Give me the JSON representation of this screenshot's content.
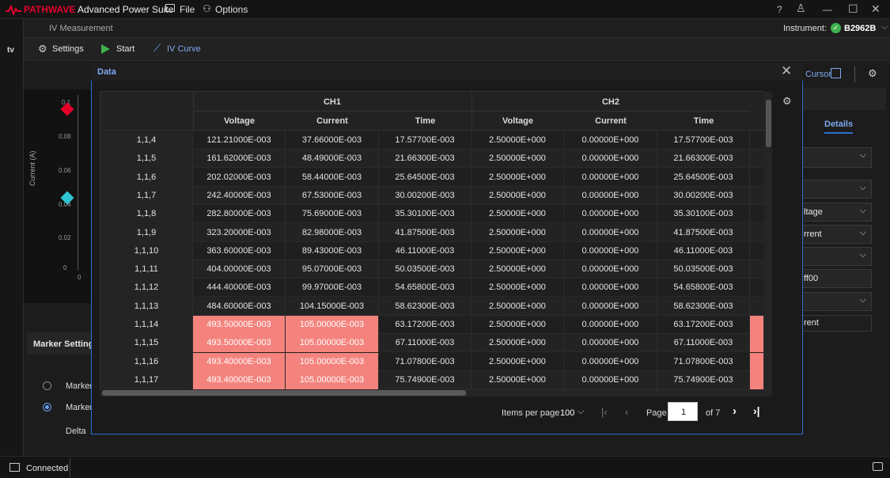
{
  "app": {
    "brand": "PATHWAVE",
    "title": "Advanced Power Suite",
    "menu_file": "File",
    "menu_options": "Options",
    "win_help": "?",
    "win_user": "♙",
    "win_min": "—",
    "win_max": "☐",
    "win_close": "✕"
  },
  "subheader": {
    "title": "IV Measurement",
    "instrument_label": "Instrument:",
    "instrument_name": "B2962B"
  },
  "toolbar": {
    "settings": "Settings",
    "start": "Start",
    "iv_curve": "IV Curve"
  },
  "left_strip": {
    "tv_label": "tv"
  },
  "chart_axis": {
    "ylabel": "Current (A)",
    "ticks": [
      "0.1",
      "0.08",
      "0.06",
      "0.04",
      "0.02",
      "0",
      "0"
    ]
  },
  "right_panel": {
    "cursor_label": "Cursor",
    "details_tab": "Details",
    "voltage_text": "ltage",
    "current_text": "rrent",
    "color_text": "ff00",
    "current_text2": "rent"
  },
  "marker": {
    "settings_label": "Marker Settings",
    "marker1": "Marker",
    "marker2": "Marker",
    "delta": "Delta"
  },
  "modal": {
    "title": "Data",
    "ch1": "CH1",
    "ch2": "CH2",
    "col_voltage": "Voltage",
    "col_current": "Current",
    "col_time": "Time",
    "rows": [
      {
        "id": "1,1,4",
        "v1": "121.21000E-003",
        "c1": "37.66000E-003",
        "t1": "17.57700E-003",
        "v2": "2.50000E+000",
        "c2": "0.00000E+000",
        "t2": "17.57700E-003",
        "hl": false
      },
      {
        "id": "1,1,5",
        "v1": "161.62000E-003",
        "c1": "48.49000E-003",
        "t1": "21.66300E-003",
        "v2": "2.50000E+000",
        "c2": "0.00000E+000",
        "t2": "21.66300E-003",
        "hl": false
      },
      {
        "id": "1,1,6",
        "v1": "202.02000E-003",
        "c1": "58.44000E-003",
        "t1": "25.64500E-003",
        "v2": "2.50000E+000",
        "c2": "0.00000E+000",
        "t2": "25.64500E-003",
        "hl": false
      },
      {
        "id": "1,1,7",
        "v1": "242.40000E-003",
        "c1": "67.53000E-003",
        "t1": "30.00200E-003",
        "v2": "2.50000E+000",
        "c2": "0.00000E+000",
        "t2": "30.00200E-003",
        "hl": false
      },
      {
        "id": "1,1,8",
        "v1": "282.80000E-003",
        "c1": "75.69000E-003",
        "t1": "35.30100E-003",
        "v2": "2.50000E+000",
        "c2": "0.00000E+000",
        "t2": "35.30100E-003",
        "hl": false
      },
      {
        "id": "1,1,9",
        "v1": "323.20000E-003",
        "c1": "82.98000E-003",
        "t1": "41.87500E-003",
        "v2": "2.50000E+000",
        "c2": "0.00000E+000",
        "t2": "41.87500E-003",
        "hl": false
      },
      {
        "id": "1,1,10",
        "v1": "363.60000E-003",
        "c1": "89.43000E-003",
        "t1": "46.11000E-003",
        "v2": "2.50000E+000",
        "c2": "0.00000E+000",
        "t2": "46.11000E-003",
        "hl": false
      },
      {
        "id": "1,1,11",
        "v1": "404.00000E-003",
        "c1": "95.07000E-003",
        "t1": "50.03500E-003",
        "v2": "2.50000E+000",
        "c2": "0.00000E+000",
        "t2": "50.03500E-003",
        "hl": false
      },
      {
        "id": "1,1,12",
        "v1": "444.40000E-003",
        "c1": "99.97000E-003",
        "t1": "54.65800E-003",
        "v2": "2.50000E+000",
        "c2": "0.00000E+000",
        "t2": "54.65800E-003",
        "hl": false
      },
      {
        "id": "1,1,13",
        "v1": "484.60000E-003",
        "c1": "104.15000E-003",
        "t1": "58.62300E-003",
        "v2": "2.50000E+000",
        "c2": "0.00000E+000",
        "t2": "58.62300E-003",
        "hl": false
      },
      {
        "id": "1,1,14",
        "v1": "493.50000E-003",
        "c1": "105.00000E-003",
        "t1": "63.17200E-003",
        "v2": "2.50000E+000",
        "c2": "0.00000E+000",
        "t2": "63.17200E-003",
        "hl": true
      },
      {
        "id": "1,1,15",
        "v1": "493.50000E-003",
        "c1": "105.00000E-003",
        "t1": "67.11000E-003",
        "v2": "2.50000E+000",
        "c2": "0.00000E+000",
        "t2": "67.11000E-003",
        "hl": true
      },
      {
        "id": "1,1,16",
        "v1": "493.40000E-003",
        "c1": "105.00000E-003",
        "t1": "71.07800E-003",
        "v2": "2.50000E+000",
        "c2": "0.00000E+000",
        "t2": "71.07800E-003",
        "hl": true
      },
      {
        "id": "1,1,17",
        "v1": "493.40000E-003",
        "c1": "105.00000E-003",
        "t1": "75.74900E-003",
        "v2": "2.50000E+000",
        "c2": "0.00000E+000",
        "t2": "75.74900E-003",
        "hl": true
      }
    ],
    "items_per_page_label": "Items per page",
    "items_per_page": "100",
    "page_label": "Page",
    "page_value": "1",
    "of_pages": "of 7"
  },
  "status": {
    "connected": "Connected"
  },
  "colors": {
    "accent": "#2f6fd1",
    "highlight": "#f4837d",
    "brand_red": "#e4002b",
    "ok_green": "#3fb34f"
  }
}
